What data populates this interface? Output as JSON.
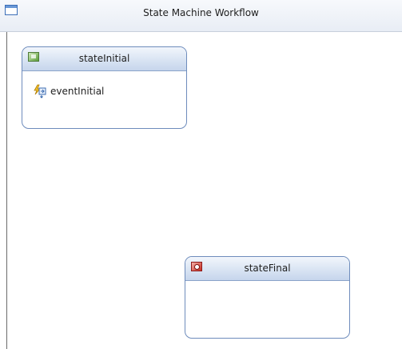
{
  "workflow": {
    "title": "State Machine Workflow",
    "icon": "workflow-icon"
  },
  "states": {
    "initial": {
      "title": "stateInitial",
      "icon": "state-initial-icon",
      "events": [
        {
          "label": "eventInitial",
          "icon": "event-driven-icon"
        }
      ]
    },
    "final": {
      "title": "stateFinal",
      "icon": "state-final-icon"
    }
  },
  "colors": {
    "state_border": "#6e8cbc",
    "state_header": "#d9e4f3",
    "initial_icon": "#5c9e3a",
    "final_icon": "#c72e22"
  }
}
